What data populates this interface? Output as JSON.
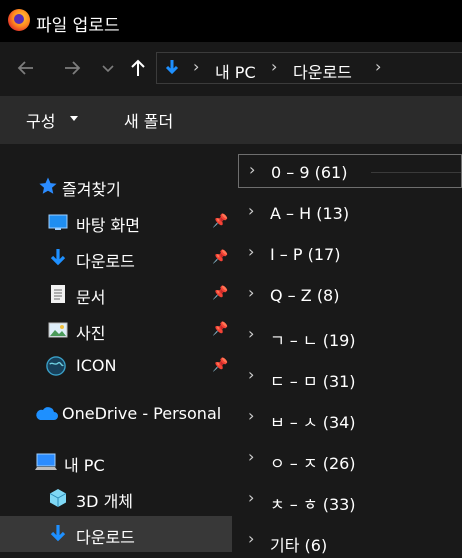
{
  "window": {
    "title": "파일 업로드"
  },
  "nav": {
    "back_icon": "arrow-left-icon",
    "forward_icon": "arrow-right-icon",
    "recent_icon": "chevron-down-icon",
    "up_icon": "arrow-up-icon",
    "breadcrumb": [
      "내 PC",
      "다운로드"
    ]
  },
  "toolbar": {
    "organize_label": "구성",
    "new_folder_label": "새 폴더"
  },
  "sidebar": {
    "quick_access_label": "즐겨찾기",
    "quick_items": [
      "바탕 화면",
      "다운로드",
      "문서",
      "사진",
      "ICON"
    ],
    "onedrive_label": "OneDrive - Personal",
    "this_pc_label": "내 PC",
    "pc_items": [
      "3D 개체",
      "다운로드"
    ]
  },
  "groups": [
    {
      "label": "0 – 9 (61)"
    },
    {
      "label": "A – H (13)"
    },
    {
      "label": "I – P (17)"
    },
    {
      "label": "Q – Z (8)"
    },
    {
      "label": "ㄱ – ㄴ (19)"
    },
    {
      "label": "ㄷ – ㅁ (31)"
    },
    {
      "label": "ㅂ – ㅅ (34)"
    },
    {
      "label": "ㅇ – ㅈ (26)"
    },
    {
      "label": "ㅊ – ㅎ (33)"
    },
    {
      "label": "기타 (6)"
    }
  ],
  "colors": {
    "accent": "#1e90ff",
    "background": "#191919",
    "toolbar": "#2b2b2b",
    "selected": "#383838"
  }
}
